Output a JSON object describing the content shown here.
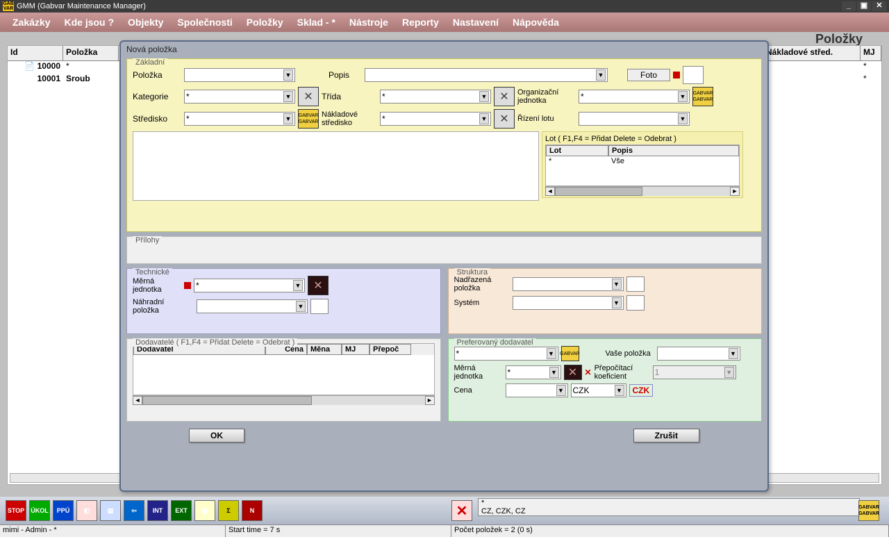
{
  "titlebar": {
    "app": "GMM (Gabvar Maintenance Manager)"
  },
  "menu": [
    "Zakázky",
    "Kde jsou ?",
    "Objekty",
    "Společnosti",
    "Položky",
    "Sklad - *",
    "Nástroje",
    "Reporty",
    "Nastavení",
    "Nápověda"
  ],
  "heading": {
    "right": "Položky"
  },
  "grid": {
    "headers": [
      "Id",
      "Položka",
      "Nákladové střed.",
      "MJ"
    ],
    "rows": [
      {
        "id": "10000",
        "polozka": "*",
        "nstred": "",
        "mj": "*"
      },
      {
        "id": "10001",
        "polozka": "Sroub",
        "nstred": "",
        "mj": "*"
      }
    ]
  },
  "dialog": {
    "title": "Nová položka",
    "group_zakladni": "Základní",
    "lbl_polozka": "Položka",
    "lbl_popis": "Popis",
    "btn_foto": "Foto",
    "lbl_kategorie": "Kategorie",
    "val_kategorie": "*",
    "lbl_trida": "Třída",
    "val_trida": "*",
    "lbl_org": "Organizační jednotka",
    "val_org": "*",
    "lbl_stredisko": "Středisko",
    "val_stredisko": "*",
    "lbl_nakl": "Nákladové středisko",
    "val_nakl": "*",
    "lbl_rizeni": "Řízení lotu",
    "lot_title": "Lot ( F1,F4 = Přidat Delete = Odebrat )",
    "lot_h1": "Lot",
    "lot_h2": "Popis",
    "lot_r1c1": "*",
    "lot_r1c2": "Vše",
    "group_prilohy": "Přílohy",
    "group_tech": "Technické",
    "lbl_mj": "Měrná jednotka",
    "val_mj": "*",
    "lbl_nahr": "Náhradní položka",
    "group_struktura": "Struktura",
    "lbl_nadraz": "Nadřazená položka",
    "lbl_system": "Systém",
    "group_dodav": "Dodavatelé ( F1,F4 = Přidat Delete = Odebrat )",
    "dodav_h1": "Dodavatel",
    "dodav_h2": "Cena",
    "dodav_h3": "Měna",
    "dodav_h4": "MJ",
    "dodav_h5": "Přepoč",
    "group_pref": "Preferovaný dodavatel",
    "val_pref": "*",
    "lbl_vase": "Vaše položka",
    "lbl_pmj": "Měrná jednotka",
    "val_pmj": "*",
    "lbl_koef": "Přepočítací koeficient",
    "val_koef": "1",
    "lbl_cena": "Cena",
    "val_mena": "CZK",
    "btn_ok": "OK",
    "btn_zrusit": "Zrušit"
  },
  "toolbar": {
    "icons": [
      "STOP",
      "ÚKOL",
      "PPÚ"
    ],
    "info1": "*",
    "info2": "CZ, CZK, CZ"
  },
  "status": {
    "user": "mimi - Admin - *",
    "start": "Start time = 7 s",
    "count": "Počet položek = 2   (0 s)"
  }
}
